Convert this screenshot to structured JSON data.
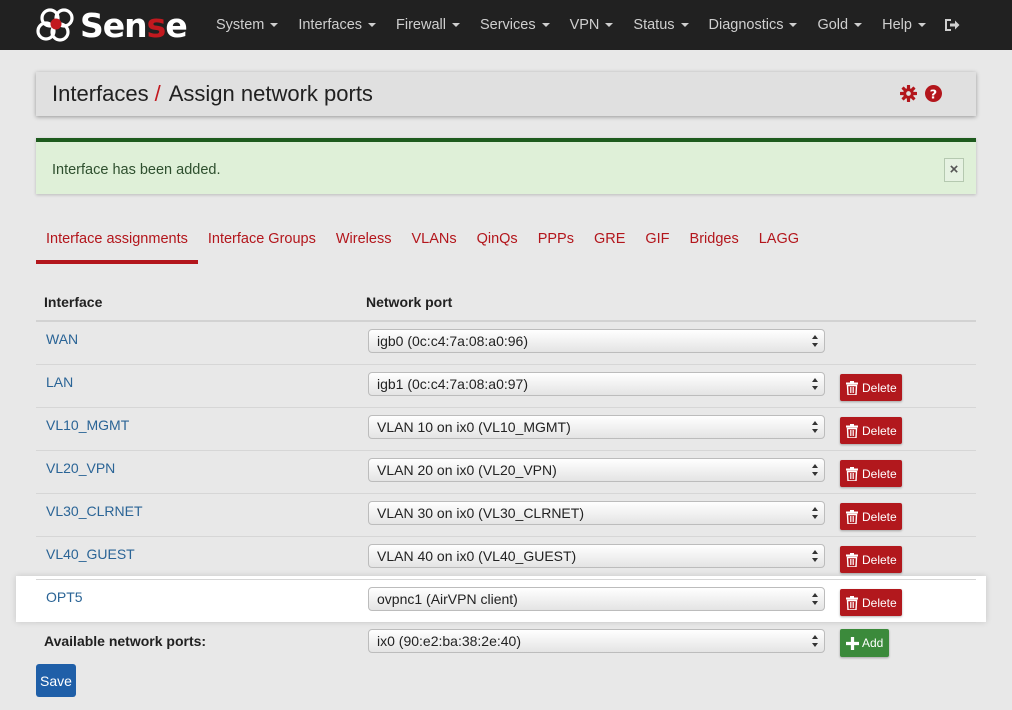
{
  "navbar": {
    "brand": {
      "prefix": "Sen",
      "red": "s",
      "suffix": "e"
    },
    "items": [
      {
        "label": "System"
      },
      {
        "label": "Interfaces"
      },
      {
        "label": "Firewall"
      },
      {
        "label": "Services"
      },
      {
        "label": "VPN"
      },
      {
        "label": "Status"
      },
      {
        "label": "Diagnostics"
      },
      {
        "label": "Gold"
      },
      {
        "label": "Help"
      }
    ],
    "logout_icon": "sign-out-icon"
  },
  "header": {
    "crumb1": "Interfaces",
    "separator": "/",
    "crumb2": "Assign network ports",
    "icons": [
      "gear-icon",
      "help-icon"
    ]
  },
  "alert": {
    "message": "Interface has been added.",
    "close": "×"
  },
  "tabs": [
    {
      "label": "Interface assignments",
      "active": true
    },
    {
      "label": "Interface Groups"
    },
    {
      "label": "Wireless"
    },
    {
      "label": "VLANs"
    },
    {
      "label": "QinQs"
    },
    {
      "label": "PPPs"
    },
    {
      "label": "GRE"
    },
    {
      "label": "GIF"
    },
    {
      "label": "Bridges"
    },
    {
      "label": "LAGG"
    }
  ],
  "table": {
    "headers": {
      "interface": "Interface",
      "port": "Network port"
    },
    "rows": [
      {
        "interface": "WAN",
        "port": "igb0 (0c:c4:7a:08:a0:96)",
        "delete": false
      },
      {
        "interface": "LAN",
        "port": "igb1 (0c:c4:7a:08:a0:97)",
        "delete": true
      },
      {
        "interface": "VL10_MGMT",
        "port": "VLAN 10 on ix0 (VL10_MGMT)",
        "delete": true
      },
      {
        "interface": "VL20_VPN",
        "port": "VLAN 20 on ix0 (VL20_VPN)",
        "delete": true
      },
      {
        "interface": "VL30_CLRNET",
        "port": "VLAN 30 on ix0 (VL30_CLRNET)",
        "delete": true
      },
      {
        "interface": "VL40_GUEST",
        "port": "VLAN 40 on ix0 (VL40_GUEST)",
        "delete": true
      },
      {
        "interface": "OPT5",
        "port": "ovpnc1 (AirVPN client)",
        "delete": true,
        "highlight": true
      }
    ],
    "delete_label": "Delete",
    "available": {
      "label": "Available network ports:",
      "port": "ix0 (90:e2:ba:38:2e:40)",
      "add_label": "Add"
    }
  },
  "save_label": "Save",
  "colors": {
    "navbar": "#212121",
    "accent_red": "#b2181d",
    "link_blue": "#2a6496",
    "success_green": "#3b8a3b",
    "alert_bg": "#dff0d8",
    "save_blue": "#1f5fa8"
  }
}
